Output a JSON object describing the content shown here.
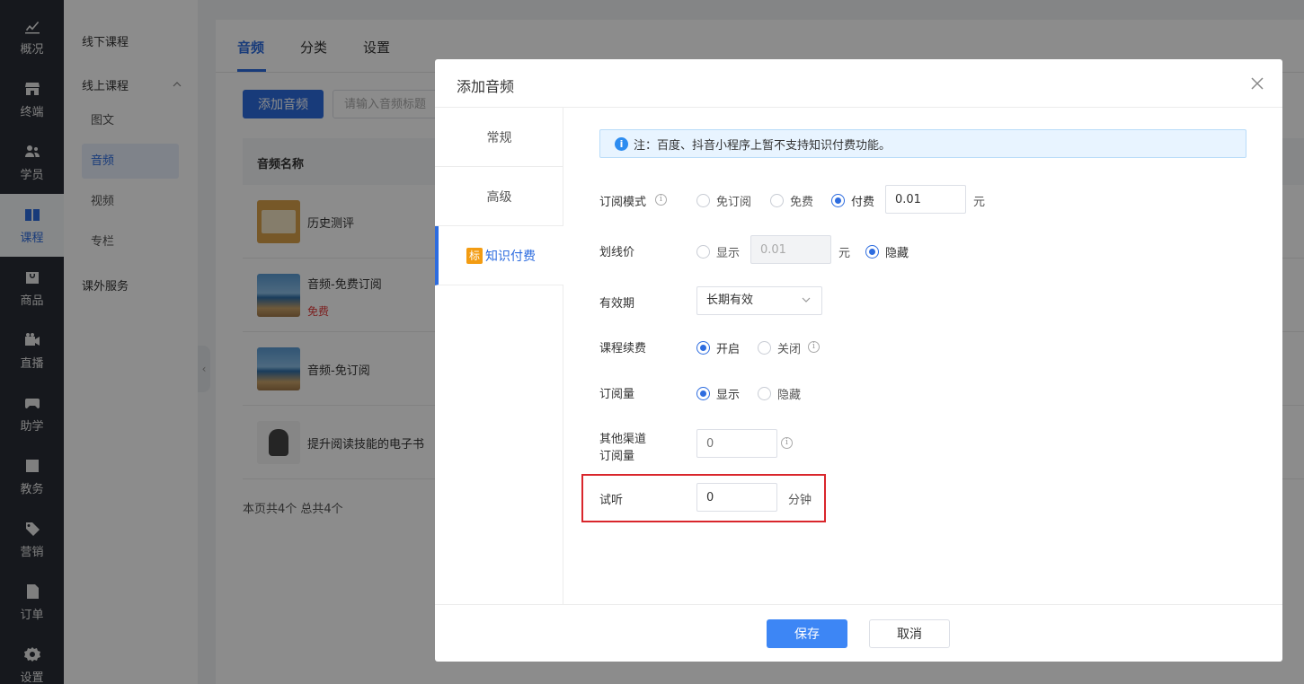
{
  "nav": {
    "items": [
      {
        "label": "概况",
        "icon": "chart-trend-icon"
      },
      {
        "label": "终端",
        "icon": "store-icon"
      },
      {
        "label": "学员",
        "icon": "users-icon"
      },
      {
        "label": "课程",
        "icon": "book-icon"
      },
      {
        "label": "商品",
        "icon": "bag-icon"
      },
      {
        "label": "直播",
        "icon": "video-camera-icon"
      },
      {
        "label": "助学",
        "icon": "gamepad-icon"
      },
      {
        "label": "教务",
        "icon": "box-icon"
      },
      {
        "label": "营销",
        "icon": "tag-icon"
      },
      {
        "label": "订单",
        "icon": "document-icon"
      },
      {
        "label": "设置",
        "icon": "gear-icon"
      }
    ],
    "active_index": 3
  },
  "subnav": {
    "offline": "线下课程",
    "online": "线上课程",
    "children": [
      "图文",
      "音频",
      "视频",
      "专栏"
    ],
    "active_child": 1,
    "extra": "课外服务"
  },
  "main": {
    "tabs": [
      "音频",
      "分类",
      "设置"
    ],
    "add_button": "添加音频",
    "search_placeholder": "请输入音频标题",
    "column_title": "音频名称",
    "rows": [
      {
        "title": "历史测评"
      },
      {
        "title": "音频-免费订阅",
        "badge": "免费"
      },
      {
        "title": "音频-免订阅"
      },
      {
        "title": "提升阅读技能的电子书"
      }
    ],
    "footer": "本页共4个 总共4个"
  },
  "modal": {
    "title": "添加音频",
    "side_tabs": [
      "常规",
      "高级",
      "知识付费"
    ],
    "active_side_tab": 2,
    "paid_tag": "标",
    "notice": "注：百度、抖音小程序上暂不支持知识付费功能。",
    "form": {
      "subscribe_mode": {
        "label": "订阅模式",
        "options": [
          "免订阅",
          "免费",
          "付费"
        ],
        "selected": "付费",
        "price": "0.01",
        "unit": "元"
      },
      "strike_price": {
        "label": "划线价",
        "show_label": "显示",
        "price": "0.01",
        "unit": "元",
        "hide_label": "隐藏",
        "selected": "隐藏"
      },
      "validity": {
        "label": "有效期",
        "value": "长期有效"
      },
      "renewal": {
        "label": "课程续费",
        "on_label": "开启",
        "off_label": "关闭",
        "selected": "开启"
      },
      "subscription_count": {
        "label": "订阅量",
        "show_label": "显示",
        "hide_label": "隐藏",
        "selected": "显示"
      },
      "other_channel": {
        "label_line1": "其他渠道",
        "label_line2": "订阅量",
        "placeholder": "0"
      },
      "trial": {
        "label": "试听",
        "value": "0",
        "unit": "分钟"
      }
    },
    "save": "保存",
    "cancel": "取消"
  },
  "colors": {
    "primary": "#2d6cdf",
    "highlight": "#d9262c",
    "nav_bg": "#282c35"
  }
}
